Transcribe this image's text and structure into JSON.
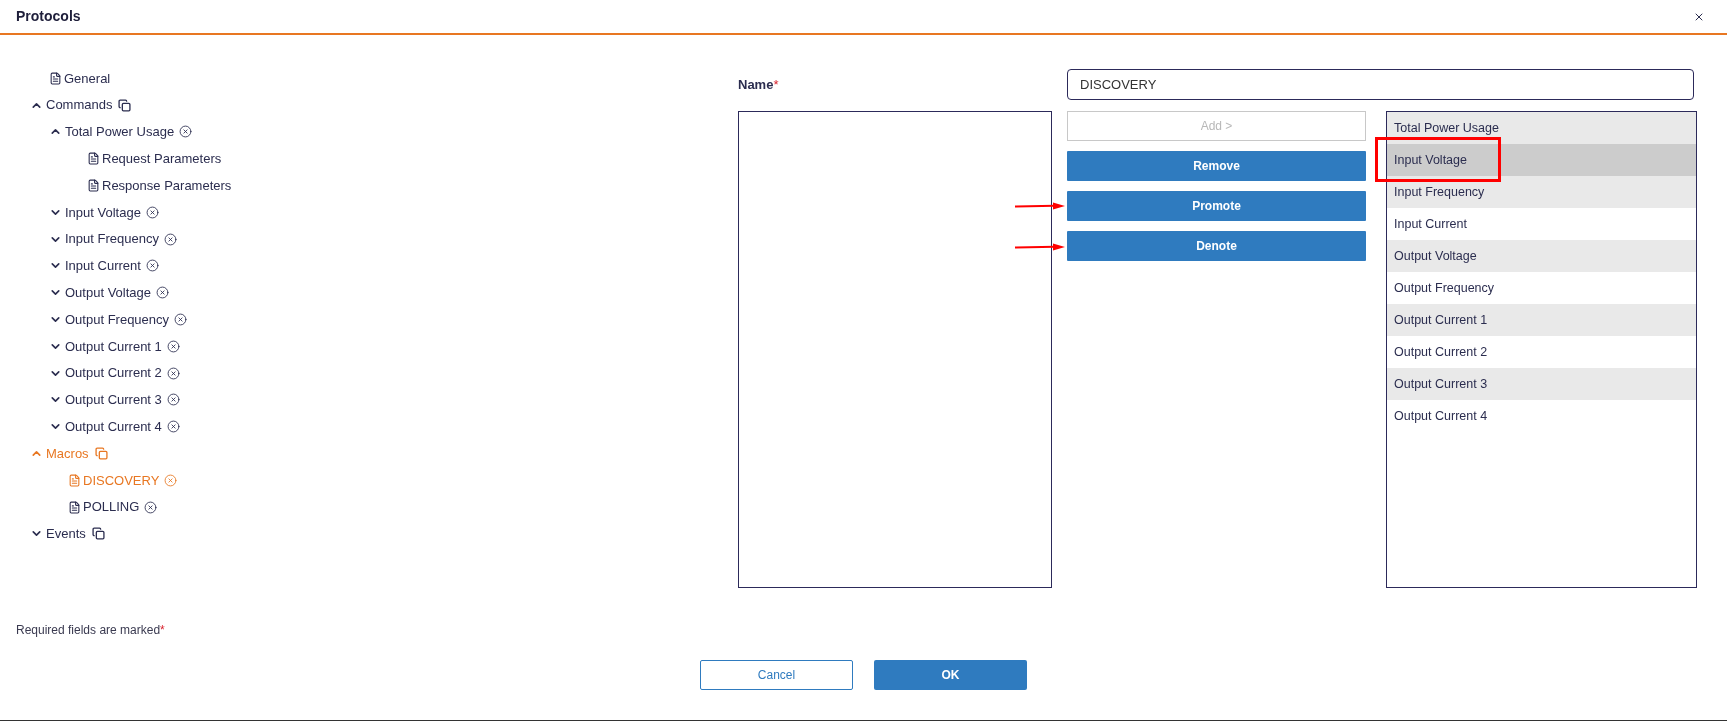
{
  "dialog": {
    "title": "Protocols"
  },
  "tree": [
    {
      "label": "General",
      "kind": "page",
      "selected": false
    },
    {
      "label": "Commands",
      "kind": "group",
      "expanded": true,
      "selected": false,
      "children": [
        {
          "label": "Total Power Usage",
          "kind": "command",
          "expanded": true,
          "selected": false,
          "children": [
            {
              "label": "Request Parameters",
              "kind": "page",
              "selected": false
            },
            {
              "label": "Response Parameters",
              "kind": "page",
              "selected": false
            }
          ]
        },
        {
          "label": "Input Voltage",
          "kind": "command",
          "expanded": false,
          "selected": false
        },
        {
          "label": "Input Frequency",
          "kind": "command",
          "expanded": false,
          "selected": false
        },
        {
          "label": "Input Current",
          "kind": "command",
          "expanded": false,
          "selected": false
        },
        {
          "label": "Output Voltage",
          "kind": "command",
          "expanded": false,
          "selected": false
        },
        {
          "label": "Output Frequency",
          "kind": "command",
          "expanded": false,
          "selected": false
        },
        {
          "label": "Output Current 1",
          "kind": "command",
          "expanded": false,
          "selected": false
        },
        {
          "label": "Output Current 2",
          "kind": "command",
          "expanded": false,
          "selected": false
        },
        {
          "label": "Output Current 3",
          "kind": "command",
          "expanded": false,
          "selected": false
        },
        {
          "label": "Output Current 4",
          "kind": "command",
          "expanded": false,
          "selected": false
        }
      ]
    },
    {
      "label": "Macros",
      "kind": "group",
      "expanded": true,
      "selected": false,
      "children": [
        {
          "label": "DISCOVERY",
          "kind": "macro",
          "selected": true
        },
        {
          "label": "POLLING",
          "kind": "macro",
          "selected": false
        }
      ]
    },
    {
      "label": "Events",
      "kind": "group",
      "expanded": false,
      "selected": false
    }
  ],
  "form": {
    "name_label": "Name",
    "required_mark": "*",
    "name_value": "DISCOVERY"
  },
  "buttons": [
    {
      "label": "Add >",
      "disabled": true
    },
    {
      "label": "Remove",
      "disabled": false
    },
    {
      "label": "Promote",
      "disabled": false
    },
    {
      "label": "Denote",
      "disabled": false
    }
  ],
  "list": [
    {
      "label": "Total Power Usage",
      "selected": false
    },
    {
      "label": "Input Voltage",
      "selected": true
    },
    {
      "label": "Input Frequency",
      "selected": false
    },
    {
      "label": "Input Current",
      "selected": false
    },
    {
      "label": "Output Voltage",
      "selected": false
    },
    {
      "label": "Output Frequency",
      "selected": false
    },
    {
      "label": "Output Current 1",
      "selected": false
    },
    {
      "label": "Output Current 2",
      "selected": false
    },
    {
      "label": "Output Current 3",
      "selected": false
    },
    {
      "label": "Output Current 4",
      "selected": false
    }
  ],
  "footer": {
    "note": "Required fields are marked",
    "required_mark": "*"
  },
  "actions": [
    {
      "label": "Cancel",
      "kind": "secondary"
    },
    {
      "label": "OK",
      "kind": "primary"
    }
  ]
}
